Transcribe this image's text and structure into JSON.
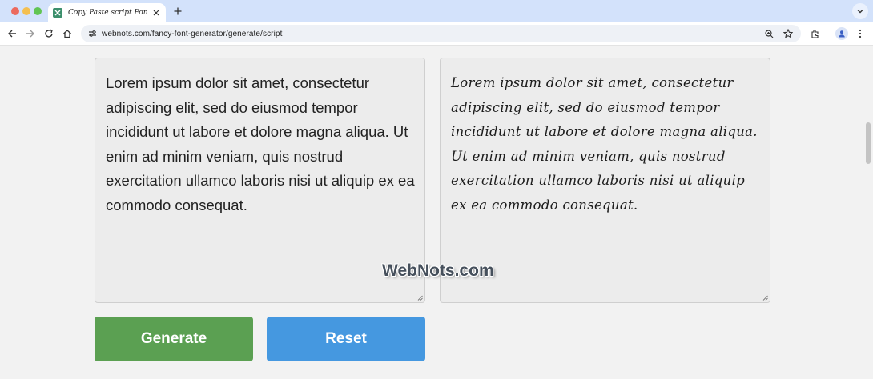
{
  "browser": {
    "tab_title": "Copy Paste script Font Generator",
    "url": "webnots.com/fancy-font-generator/generate/script"
  },
  "editor": {
    "input_text": "Lorem ipsum dolor sit amet, consectetur adipiscing elit, sed do eiusmod tempor incididunt ut labore et dolore magna aliqua. Ut enim ad minim veniam, quis nostrud exercitation ullamco laboris nisi ut aliquip ex ea commodo consequat.",
    "output_text": "Lorem ipsum dolor sit amet, consectetur adipiscing elit, sed do eiusmod tempor incididunt ut labore et dolore magna aliqua. Ut enim ad minim veniam, quis nostrud exercitation ullamco laboris nisi ut aliquip ex ea commodo consequat."
  },
  "buttons": {
    "generate_label": "Generate",
    "reset_label": "Reset"
  },
  "watermark": "WebNots.com",
  "colors": {
    "generate": "#5ba052",
    "reset": "#4598e0",
    "tabstrip": "#d3e2fb"
  }
}
